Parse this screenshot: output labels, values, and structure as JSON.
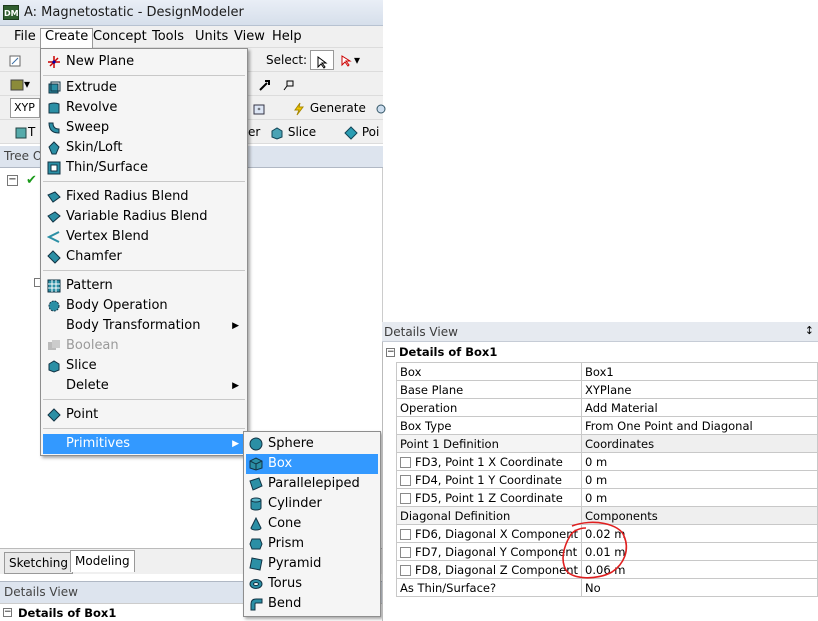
{
  "window": {
    "title": "A: Magnetostatic - DesignModeler",
    "icon_text": "DM"
  },
  "menubar": [
    "File",
    "Create",
    "Concept",
    "Tools",
    "Units",
    "View",
    "Help"
  ],
  "toolbar1": {
    "select_label": "Select:"
  },
  "toolbar3": {
    "plane_value": "XYP",
    "generate_label": "Generate"
  },
  "toolbar4": {
    "t_label": "T",
    "er_label": "er",
    "slice_label": "Slice",
    "point_label": "Poi"
  },
  "tree": {
    "header": "Tree O"
  },
  "tabs": {
    "sketching": "Sketching",
    "modeling": "Modeling"
  },
  "details_left": {
    "header": "Details View",
    "row": "Details of Box1"
  },
  "create_menu": {
    "items": [
      {
        "label": "New Plane",
        "icon": "new-plane-icon"
      },
      {
        "label": "Extrude",
        "icon": "extrude-icon"
      },
      {
        "label": "Revolve",
        "icon": "revolve-icon"
      },
      {
        "label": "Sweep",
        "icon": "sweep-icon"
      },
      {
        "label": "Skin/Loft",
        "icon": "skin-loft-icon"
      },
      {
        "label": "Thin/Surface",
        "icon": "thin-surface-icon"
      },
      {
        "label": "Fixed Radius Blend",
        "icon": "fixed-blend-icon"
      },
      {
        "label": "Variable Radius Blend",
        "icon": "variable-blend-icon"
      },
      {
        "label": "Vertex Blend",
        "icon": "vertex-blend-icon"
      },
      {
        "label": "Chamfer",
        "icon": "chamfer-icon"
      },
      {
        "label": "Pattern",
        "icon": "pattern-icon"
      },
      {
        "label": "Body Operation",
        "icon": "body-operation-icon"
      },
      {
        "label": "Body Transformation",
        "icon": "none"
      },
      {
        "label": "Boolean",
        "icon": "boolean-icon"
      },
      {
        "label": "Slice",
        "icon": "slice-icon"
      },
      {
        "label": "Delete",
        "icon": "none"
      },
      {
        "label": "Point",
        "icon": "point-icon"
      },
      {
        "label": "Primitives",
        "icon": "none"
      }
    ]
  },
  "primitives_menu": {
    "items": [
      {
        "label": "Sphere",
        "icon": "sphere-icon"
      },
      {
        "label": "Box",
        "icon": "box-icon"
      },
      {
        "label": "Parallelepiped",
        "icon": "parallelepiped-icon"
      },
      {
        "label": "Cylinder",
        "icon": "cylinder-icon"
      },
      {
        "label": "Cone",
        "icon": "cone-icon"
      },
      {
        "label": "Prism",
        "icon": "prism-icon"
      },
      {
        "label": "Pyramid",
        "icon": "pyramid-icon"
      },
      {
        "label": "Torus",
        "icon": "torus-icon"
      },
      {
        "label": "Bend",
        "icon": "bend-icon"
      }
    ]
  },
  "details_view": {
    "title": "Details View",
    "pin": "↕",
    "group": "Details of Box1",
    "rows": [
      {
        "name": "Box",
        "value": "Box1",
        "checkbox": false,
        "group": false
      },
      {
        "name": "Base Plane",
        "value": "XYPlane",
        "checkbox": false,
        "group": false
      },
      {
        "name": "Operation",
        "value": "Add Material",
        "checkbox": false,
        "group": false
      },
      {
        "name": "Box Type",
        "value": "From One Point and Diagonal",
        "checkbox": false,
        "group": false
      },
      {
        "name": "Point 1 Definition",
        "value": "Coordinates",
        "checkbox": false,
        "group": true
      },
      {
        "name": "FD3, Point 1 X Coordinate",
        "value": "0 m",
        "checkbox": true,
        "group": false
      },
      {
        "name": "FD4, Point 1 Y Coordinate",
        "value": "0 m",
        "checkbox": true,
        "group": false
      },
      {
        "name": "FD5, Point 1 Z Coordinate",
        "value": "0 m",
        "checkbox": true,
        "group": false
      },
      {
        "name": "Diagonal Definition",
        "value": "Components",
        "checkbox": false,
        "group": true
      },
      {
        "name": "FD6, Diagonal X Component",
        "value": "0.02 m",
        "checkbox": true,
        "group": false
      },
      {
        "name": "FD7, Diagonal Y Component",
        "value": "0.01 m",
        "checkbox": true,
        "group": false
      },
      {
        "name": "FD8, Diagonal Z Component",
        "value": "0.06 m",
        "checkbox": true,
        "group": false
      },
      {
        "name": "As Thin/Surface?",
        "value": "No",
        "checkbox": false,
        "group": false
      }
    ]
  },
  "colors": {
    "highlight": "#3399ff",
    "annotation": "#e02020"
  }
}
